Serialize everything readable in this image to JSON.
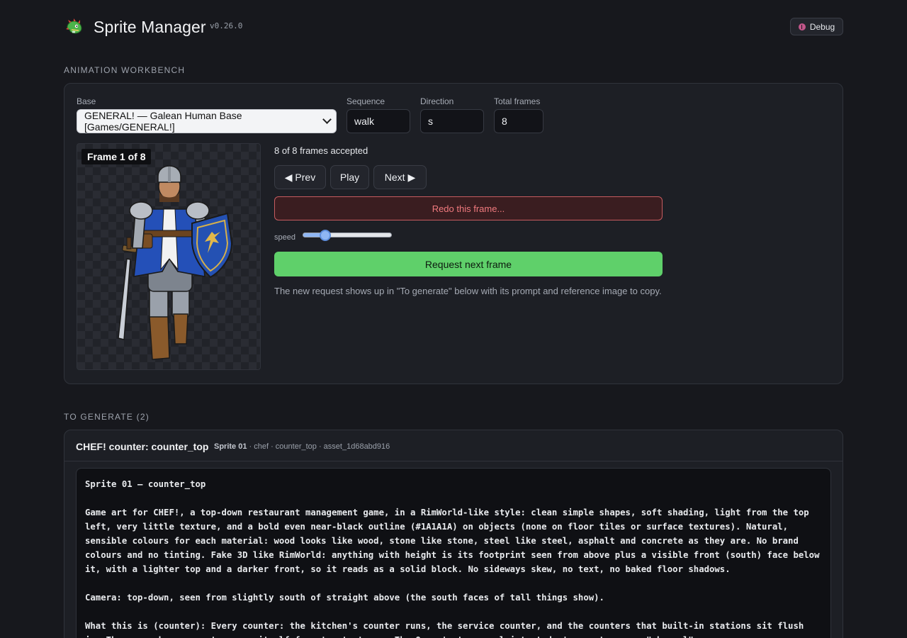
{
  "app": {
    "title": "Sprite Manager",
    "version": "v0.26.0",
    "debug_label": "Debug"
  },
  "workbench": {
    "section_title": "ANIMATION WORKBENCH",
    "base_label": "Base",
    "base_value": "GENERAL! — Galean Human Base [Games/GENERAL!]",
    "sequence_label": "Sequence",
    "sequence_value": "walk",
    "direction_label": "Direction",
    "direction_value": "s",
    "total_frames_label": "Total frames",
    "total_frames_value": "8",
    "frame_badge": "Frame 1 of 8",
    "status": "8 of 8 frames accepted",
    "prev_label": "◀ Prev",
    "play_label": "Play",
    "next_label": "Next ▶",
    "redo_label": "Redo this frame...",
    "speed_label": "speed",
    "speed_level": 0.25,
    "request_label": "Request next frame",
    "hint": "The new request shows up in \"To generate\" below with its prompt and reference image to copy."
  },
  "to_generate": {
    "section_title": "TO GENERATE (2)",
    "task": {
      "title": "CHEF! counter: counter_top",
      "meta_sprite": "Sprite 01",
      "meta_rest": " · chef · counter_top · asset_1d68abd916",
      "prompt": [
        "Sprite 01 — counter_top",
        "Game art for CHEF!, a top-down restaurant management game, in a RimWorld-like style: clean simple shapes, soft shading, light from the top left, very little texture, and a bold even near-black outline (#1A1A1A) on objects (none on floor tiles or surface textures). Natural, sensible colours for each material: wood looks like wood, stone like stone, steel like steel, asphalt and concrete as they are. No brand colours and no tinting. Fake 3D like RimWorld: anything with height is its footprint seen from above plus a visible front (south) face below it, with a lighter top and a darker front, so it reads as a solid block. No sideways skew, no text, no baked floor shadows.",
        "Camera: top-down, seen from slightly south of straight above (the south faces of tall things show).",
        "What this is (counter): Every counter: the kitchen's counter runs, the service counter, and the counters that built-in stations sit flush in. The game shapes counter runs itself from two textures. The Owner's top complaint: today's counters are \"abysmal\"."
      ]
    }
  },
  "colors": {
    "background": "#17181d",
    "panel": "#1d1f25",
    "accent_green": "#5fd06a",
    "danger_red": "#c65b5f",
    "slider_blue": "#8fb6f4"
  },
  "icons": [
    "dragon-logo-icon",
    "bug-icon"
  ]
}
